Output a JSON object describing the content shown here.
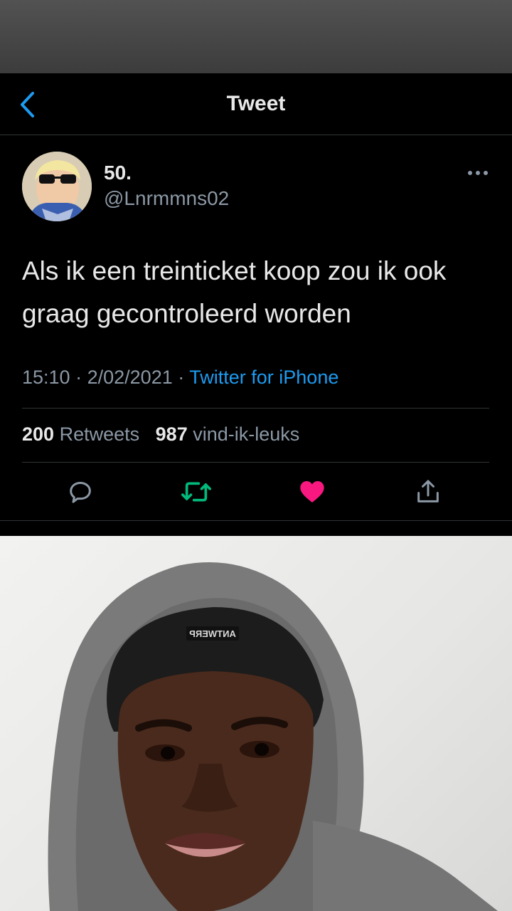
{
  "nav": {
    "back_icon": "chevron-left-icon",
    "title": "Tweet"
  },
  "tweet": {
    "author": {
      "display_name": "50.",
      "handle": "@Lnrmmns02"
    },
    "text": "Als ik een treinticket koop zou ik ook graag gecontroleerd worden",
    "time": "15:10",
    "separator": "·",
    "date": "2/02/2021",
    "source": "Twitter for iPhone",
    "stats": {
      "retweets_count": "200",
      "retweets_label": "Retweets",
      "likes_count": "987",
      "likes_label": "vind-ik-leuks"
    },
    "actions": [
      {
        "icon": "reply-icon",
        "color": "#8b98a5"
      },
      {
        "icon": "retweet-icon",
        "color": "#00ba7c"
      },
      {
        "icon": "heart-icon",
        "color": "#f91880"
      },
      {
        "icon": "share-icon",
        "color": "#8b98a5"
      }
    ]
  },
  "colors": {
    "background": "#000000",
    "accent": "#1d9bf0",
    "secondary_text": "#8b98a5",
    "retweet_active": "#00ba7c",
    "like_active": "#f91880"
  },
  "photo": {
    "beanie_label": "ANTWERP"
  }
}
